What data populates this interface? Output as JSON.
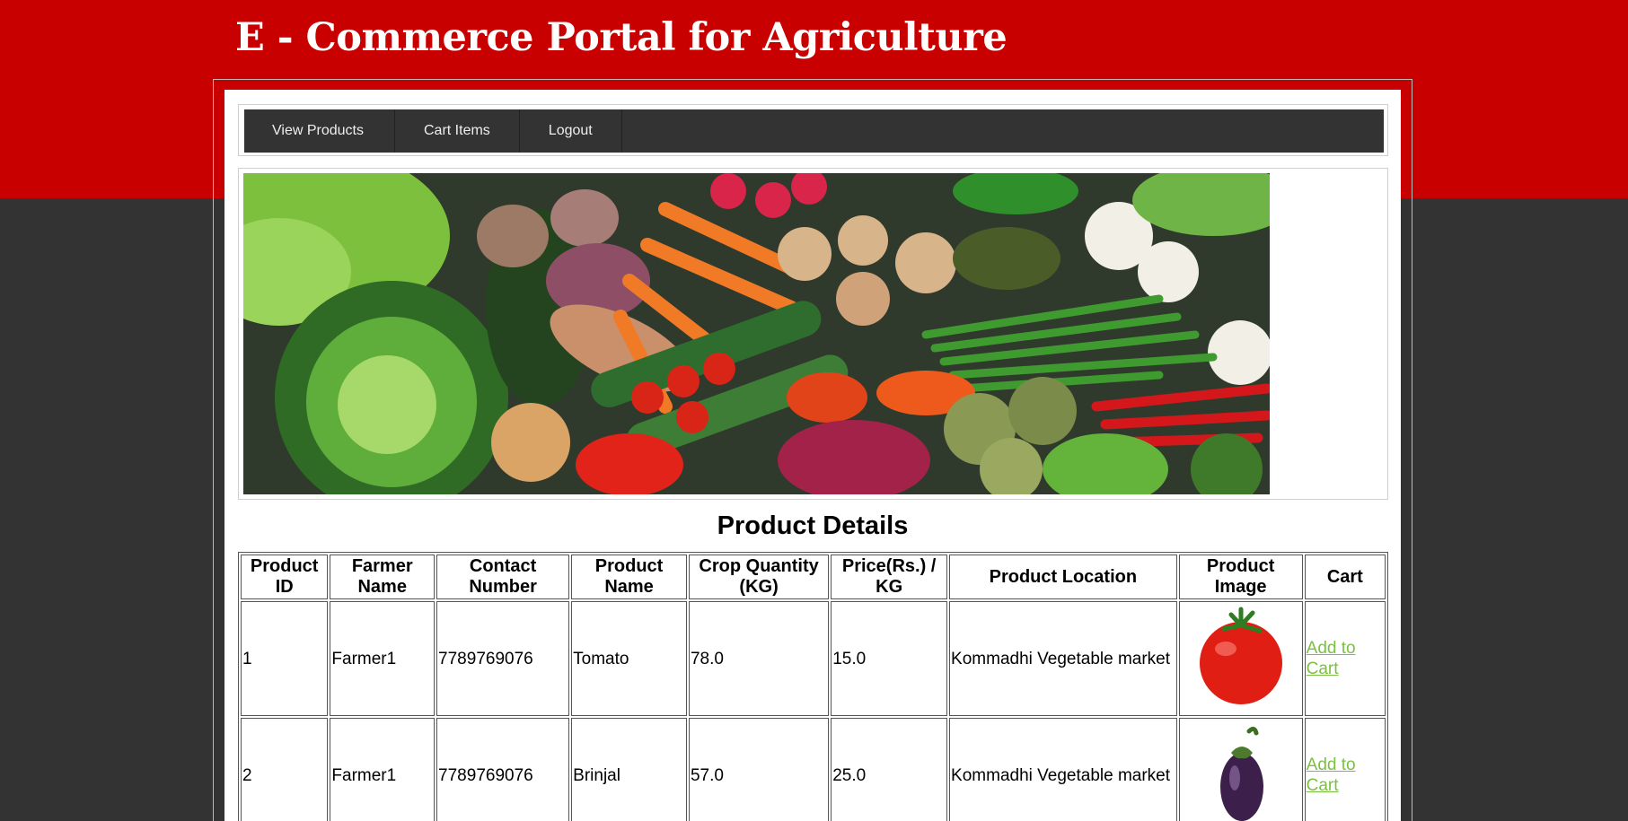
{
  "site": {
    "title": "E - Commerce Portal for Agriculture",
    "colors": {
      "header_red": "#c90000",
      "page_dark": "#333333",
      "link_green": "#7bc043"
    }
  },
  "nav": {
    "items": [
      {
        "label": "View Products"
      },
      {
        "label": "Cart Items"
      },
      {
        "label": "Logout"
      }
    ]
  },
  "banner": {
    "subject": "assorted fresh vegetables"
  },
  "products": {
    "title": "Product Details",
    "columns": [
      "Product ID",
      "Farmer Name",
      "Contact Number",
      "Product Name",
      "Crop Quantity (KG)",
      "Price(Rs.) / KG",
      "Product Location",
      "Product Image",
      "Cart"
    ],
    "rows": [
      {
        "id": "1",
        "farmer": "Farmer1",
        "contact": "7789769076",
        "name": "Tomato",
        "quantity": "78.0",
        "price": "15.0",
        "location": "Kommadhi Vegetable market",
        "image_icon": "tomato-icon",
        "cart_label": "Add to Cart"
      },
      {
        "id": "2",
        "farmer": "Farmer1",
        "contact": "7789769076",
        "name": "Brinjal",
        "quantity": "57.0",
        "price": "25.0",
        "location": "Kommadhi Vegetable market",
        "image_icon": "brinjal-icon",
        "cart_label": "Add to Cart"
      }
    ]
  }
}
